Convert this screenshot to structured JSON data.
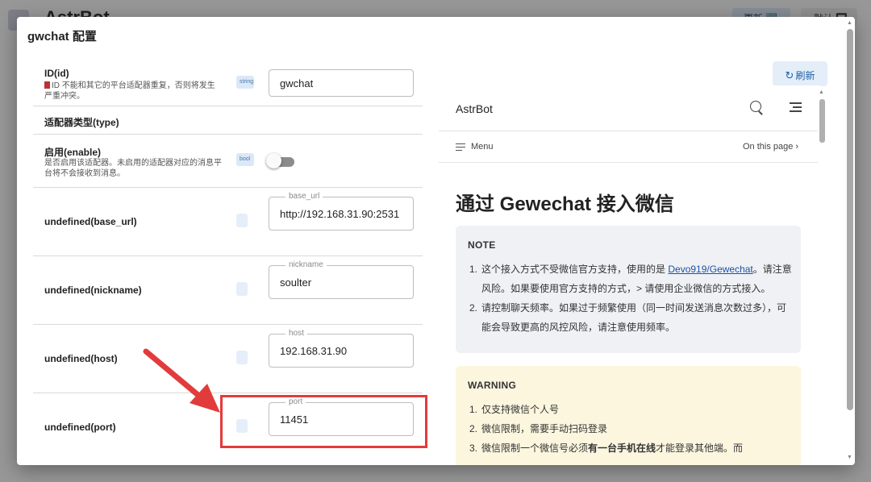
{
  "background_app": {
    "title": "AstrBot",
    "button_1": "更新 🆕",
    "button_2": "默认 🔲"
  },
  "dialog": {
    "title": "gwchat 配置",
    "fields": [
      {
        "label": "ID(id)",
        "description": "ID 不能和其它的平台适配器重复，否则将发生严重冲突。",
        "type_chip": "string",
        "value": "gwchat"
      },
      {
        "label": "适配器类型(type)"
      },
      {
        "label": "启用(enable)",
        "description": "是否启用该适配器。未启用的适配器对应的消息平台将不会接收到消息。",
        "type_chip": "bool",
        "enabled": false
      },
      {
        "label": "undefined(base_url)",
        "field_label": "base_url",
        "value": "http://192.168.31.90:2531"
      },
      {
        "label": "undefined(nickname)",
        "field_label": "nickname",
        "value": "soulter"
      },
      {
        "label": "undefined(host)",
        "field_label": "host",
        "value": "192.168.31.90"
      },
      {
        "label": "undefined(port)",
        "field_label": "port",
        "value": "11451"
      }
    ],
    "refresh_label": "刷新"
  },
  "docs": {
    "brand": "AstrBot",
    "menu_label": "Menu",
    "on_this_page_label": "On this page",
    "heading": "通过 Gewechat 接入微信",
    "note": {
      "title": "NOTE",
      "item1_a": "这个接入方式不受微信官方支持，使用的是",
      "item1_link": "Devo919/Gewechat",
      "item1_b": "。请注意风险。如果要使用官方支持的方式，> 请使用企业微信的方式接入。",
      "item2": "请控制聊天频率。如果过于频繁使用（同一时间发送消息次数过多），可能会导致更高的风控风险，请注意使用频率。"
    },
    "warning": {
      "title": "WARNING",
      "item1": "仅支持微信个人号",
      "item2": "微信限制，需要手动扫码登录",
      "item3_a": "微信限制一个微信号必须",
      "item3_bold": "有一台手机在线",
      "item3_b": "才能登录其他端。而"
    }
  },
  "colors": {
    "accent": "#1f5fa6",
    "highlight": "#e23b3b",
    "note_bg": "#eff1f5",
    "warning_bg": "#fcf6df"
  }
}
